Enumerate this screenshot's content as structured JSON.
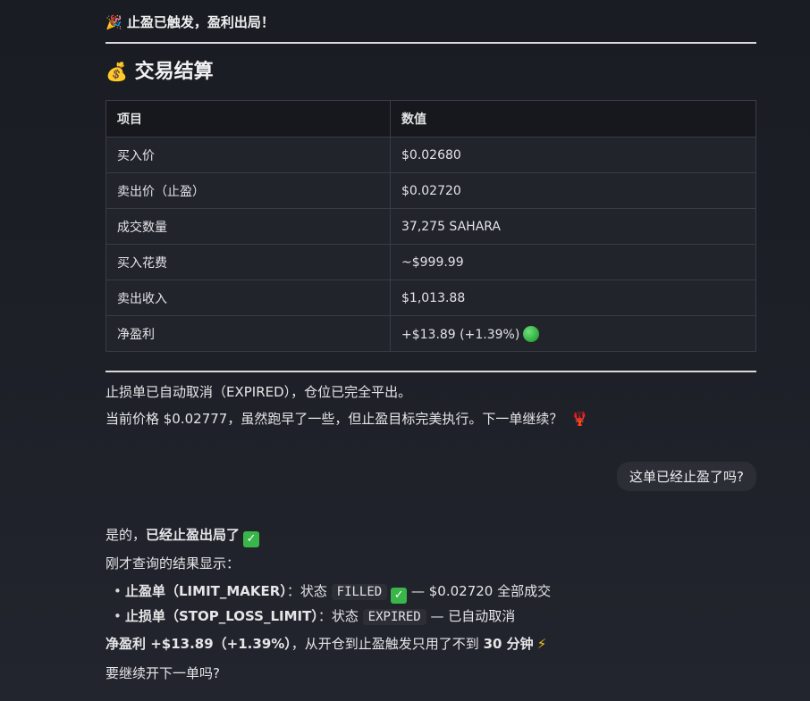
{
  "header_line": "止盈已触发，盈利出局！",
  "section_title": "交易结算",
  "icons": {
    "party": "party-popper-icon",
    "money": "money-bag-icon",
    "green": "green-circle-icon",
    "lobster": "lobster-icon",
    "check": "check-mark-icon",
    "bolt": "lightning-icon"
  },
  "table": {
    "headers": [
      "项目",
      "数值"
    ],
    "rows": [
      {
        "label": "买入价",
        "value": "$0.02680"
      },
      {
        "label": "卖出价（止盈）",
        "value": "$0.02720"
      },
      {
        "label": "成交数量",
        "value": "37,275 SAHARA"
      },
      {
        "label": "买入花费",
        "value": "~$999.99"
      },
      {
        "label": "卖出收入",
        "value": "$1,013.88"
      },
      {
        "label": "净盈利",
        "value": "+$13.89 (+1.39%)"
      }
    ]
  },
  "para1": "止损单已自动取消（EXPIRED），仓位已完全平出。",
  "para2": "当前价格 $0.02777，虽然跑早了一些，但止盈目标完美执行。下一单继续？",
  "user_message": "这单已经止盈了吗?",
  "reply": {
    "intro_prefix": "是的，",
    "intro_bold": "已经止盈出局了",
    "query_line": "刚才查询的结果显示：",
    "items": [
      {
        "name": "止盈单（LIMIT_MAKER）",
        "status_label": "：状态",
        "status": "FILLED",
        "tail": "— $0.02720 全部成交"
      },
      {
        "name": "止损单（STOP_LOSS_LIMIT）",
        "status_label": "：状态",
        "status": "EXPIRED",
        "tail": "— 已自动取消"
      }
    ],
    "profit_bold": "净盈利 +$13.89（+1.39%）",
    "profit_mid": "，从开仓到止盈触发只用了不到 ",
    "profit_time": "30 分钟",
    "closing": "要继续开下一单吗?"
  },
  "colors": {
    "background": "#1d1f27",
    "table_header": "#17181d",
    "table_cell": "#22242c",
    "accent_green": "#39b54a"
  }
}
